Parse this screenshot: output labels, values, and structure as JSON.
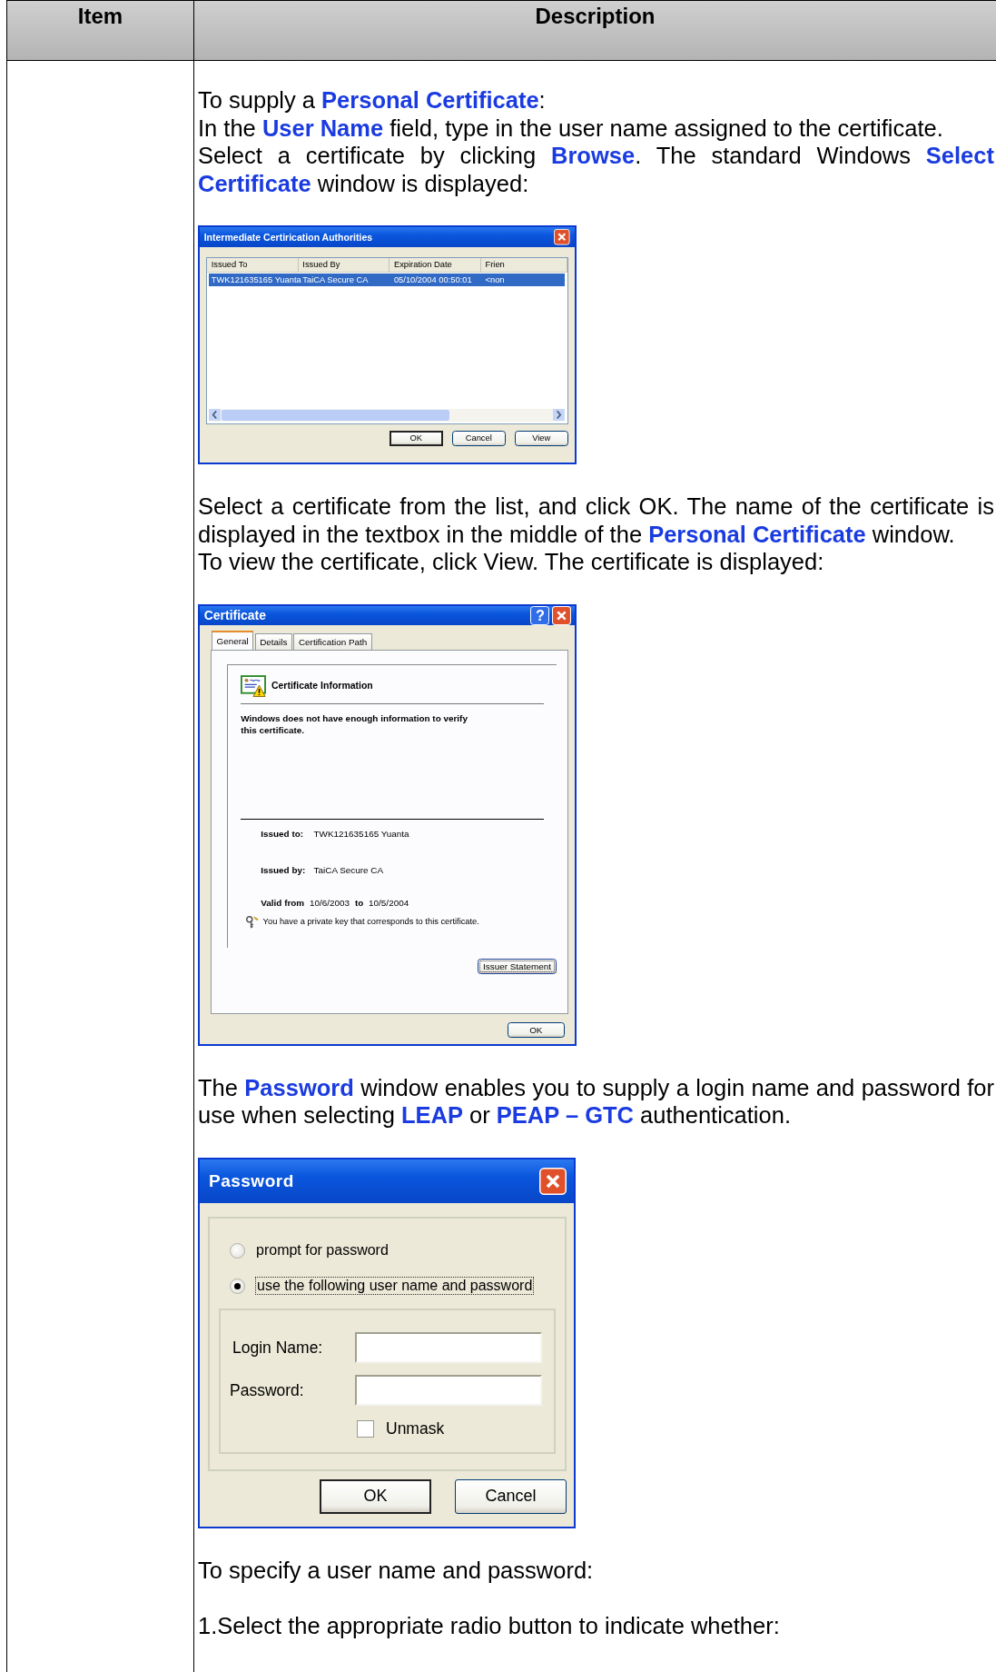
{
  "table": {
    "columns": [
      "Item",
      "Description"
    ],
    "rows": [
      {
        "description": [
          {
            "kind": "text",
            "paragraphs": [
              "To supply a **Personal Certificate**:",
              "In the **User Name** field, type in the user name assigned to the certificate.",
              "Select a certificate by clicking **Browse**. The standard Windows **Select Certificate** window is displayed:"
            ]
          },
          {
            "kind": "cert_list",
            "title": "Intermediate Certirication Authorities",
            "columns": [
              "Issued To",
              "Issued By",
              "Expiration Date",
              "Frien"
            ],
            "rows": [
              {
                "cells": [
                  "TWK121635165 Yuanta",
                  "TaiCA Secure CA",
                  "05/10/2004 00:50:01",
                  "<non"
                ],
                "selected": true
              }
            ],
            "buttons": [
              "OK",
              "Cancel",
              "View"
            ]
          },
          {
            "kind": "text",
            "paragraphs": [
              "Select a certificate from the list, and click OK. The name of the certificate is displayed in the textbox in the middle of the **Personal Certificate** window.",
              "To view the certificate, click View. The certificate is displayed:"
            ]
          },
          {
            "kind": "certificate",
            "title": "Certificate",
            "help": "?",
            "tabs": [
              {
                "label": "General",
                "selected": true
              },
              {
                "label": "Details",
                "selected": false
              },
              {
                "label": "Certification Path",
                "selected": false
              }
            ],
            "heading": "Certificate Information",
            "message": "Windows does not have enough information to verify this certificate.",
            "issued_to_label": "Issued to:",
            "issued_to": "TWK121635165 Yuanta",
            "issued_by_label": "Issued by:",
            "issued_by": "TaiCA Secure CA",
            "valid_from_label": "Valid from",
            "valid_from": "10/6/2003",
            "valid_to_label": "to",
            "valid_to": "10/5/2004",
            "key_note": "You have a private key that corresponds to this certificate.",
            "buttons": [
              "Issuer Statement",
              "OK"
            ]
          },
          {
            "kind": "text",
            "paragraphs": [
              "The **Password** window enables you to supply a login name and password for use when selecting **LEAP** or **PEAP – GTC** authentication."
            ]
          },
          {
            "kind": "password",
            "title": "Password",
            "options": [
              {
                "label": "prompt for password",
                "selected": false
              },
              {
                "label": "use the following user name and password",
                "selected": true
              }
            ],
            "fields": [
              {
                "label": "Login Name:"
              },
              {
                "label": "Password:"
              }
            ],
            "checkbox": {
              "label": "Unmask",
              "checked": false
            },
            "buttons": [
              "OK",
              "Cancel"
            ]
          },
          {
            "kind": "text",
            "paragraphs": [
              "To specify a user name and password:"
            ]
          },
          {
            "kind": "text",
            "paragraphs": [
              "1.Select the appropriate radio button to indicate whether:"
            ]
          }
        ]
      }
    ]
  }
}
